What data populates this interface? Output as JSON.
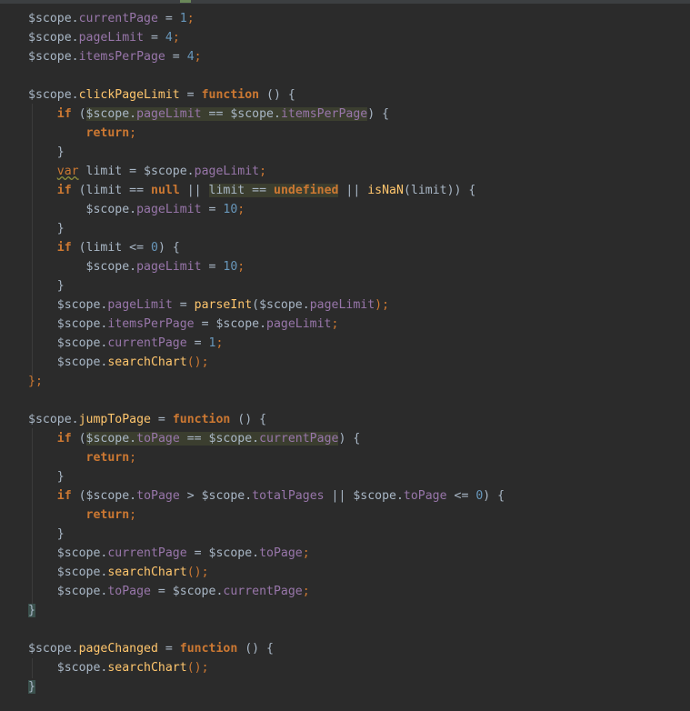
{
  "editor": {
    "language": "javascript",
    "theme": "darcula",
    "lines": [
      [
        [
          "$scope.",
          "plain"
        ],
        [
          "currentPage",
          "prop"
        ],
        [
          " = ",
          "plain"
        ],
        [
          "1",
          "num"
        ],
        [
          ";",
          "kwp"
        ]
      ],
      [
        [
          "$scope.",
          "plain"
        ],
        [
          "pageLimit",
          "prop"
        ],
        [
          " = ",
          "plain"
        ],
        [
          "4",
          "num"
        ],
        [
          ";",
          "kwp"
        ]
      ],
      [
        [
          "$scope.",
          "plain"
        ],
        [
          "itemsPerPage",
          "prop"
        ],
        [
          " = ",
          "plain"
        ],
        [
          "4",
          "num"
        ],
        [
          ";",
          "kwp"
        ]
      ],
      [],
      [
        [
          "$scope.",
          "plain"
        ],
        [
          "clickPageLimit",
          "fn"
        ],
        [
          " = ",
          "plain"
        ],
        [
          "function",
          "kw"
        ],
        [
          " () {",
          "plain"
        ]
      ],
      [
        [
          "    ",
          "plain"
        ],
        [
          "if",
          "kw"
        ],
        [
          " (",
          "plain"
        ],
        [
          "$scope.",
          "plain hl"
        ],
        [
          "pageLimit",
          "prop hl"
        ],
        [
          " == $scope.",
          "plain hl"
        ],
        [
          "itemsPerPage",
          "prop hl"
        ],
        [
          ") {",
          "plain"
        ]
      ],
      [
        [
          "        ",
          "plain"
        ],
        [
          "return",
          "kw"
        ],
        [
          ";",
          "kwp"
        ]
      ],
      [
        [
          "    }",
          "plain"
        ]
      ],
      [
        [
          "    ",
          "plain"
        ],
        [
          "var",
          "kwp squig"
        ],
        [
          " limit = $scope.",
          "plain"
        ],
        [
          "pageLimit",
          "prop"
        ],
        [
          ";",
          "kwp"
        ]
      ],
      [
        [
          "    ",
          "plain"
        ],
        [
          "if",
          "kw"
        ],
        [
          " (limit == ",
          "plain"
        ],
        [
          "null",
          "kw"
        ],
        [
          " || ",
          "plain"
        ],
        [
          "limit == ",
          "plain hl"
        ],
        [
          "undefined",
          "kw hl"
        ],
        [
          " || ",
          "plain"
        ],
        [
          "isNaN",
          "fn"
        ],
        [
          "(limit)) {",
          "plain"
        ]
      ],
      [
        [
          "        $scope.",
          "plain"
        ],
        [
          "pageLimit",
          "prop"
        ],
        [
          " = ",
          "plain"
        ],
        [
          "10",
          "num"
        ],
        [
          ";",
          "kwp"
        ]
      ],
      [
        [
          "    }",
          "plain"
        ]
      ],
      [
        [
          "    ",
          "plain"
        ],
        [
          "if",
          "kw"
        ],
        [
          " (limit <= ",
          "plain"
        ],
        [
          "0",
          "num"
        ],
        [
          ") {",
          "plain"
        ]
      ],
      [
        [
          "        $scope.",
          "plain"
        ],
        [
          "pageLimit",
          "prop"
        ],
        [
          " = ",
          "plain"
        ],
        [
          "10",
          "num"
        ],
        [
          ";",
          "kwp"
        ]
      ],
      [
        [
          "    }",
          "plain"
        ]
      ],
      [
        [
          "    $scope.",
          "plain"
        ],
        [
          "pageLimit",
          "prop"
        ],
        [
          " = ",
          "plain"
        ],
        [
          "parseInt",
          "fn"
        ],
        [
          "($scope.",
          "plain"
        ],
        [
          "pageLimit",
          "prop"
        ],
        [
          ");",
          "kwp"
        ]
      ],
      [
        [
          "    $scope.",
          "plain"
        ],
        [
          "itemsPerPage",
          "prop"
        ],
        [
          " = $scope.",
          "plain"
        ],
        [
          "pageLimit",
          "prop"
        ],
        [
          ";",
          "kwp"
        ]
      ],
      [
        [
          "    $scope.",
          "plain"
        ],
        [
          "currentPage",
          "prop"
        ],
        [
          " = ",
          "plain"
        ],
        [
          "1",
          "num"
        ],
        [
          ";",
          "kwp"
        ]
      ],
      [
        [
          "    $scope.",
          "plain"
        ],
        [
          "searchChart",
          "fn"
        ],
        [
          "();",
          "kwp"
        ]
      ],
      [
        [
          "};",
          "kwp"
        ]
      ],
      [],
      [
        [
          "$scope.",
          "plain"
        ],
        [
          "jumpToPage",
          "fn"
        ],
        [
          " = ",
          "plain"
        ],
        [
          "function",
          "kw"
        ],
        [
          " () {",
          "plain"
        ]
      ],
      [
        [
          "    ",
          "plain"
        ],
        [
          "if",
          "kw"
        ],
        [
          " (",
          "plain"
        ],
        [
          "$scope.",
          "plain hl"
        ],
        [
          "toPage",
          "prop hl"
        ],
        [
          " == $scope.",
          "plain hl"
        ],
        [
          "currentPage",
          "prop hl"
        ],
        [
          ") {",
          "plain"
        ]
      ],
      [
        [
          "        ",
          "plain"
        ],
        [
          "return",
          "kw"
        ],
        [
          ";",
          "kwp"
        ]
      ],
      [
        [
          "    }",
          "plain"
        ]
      ],
      [
        [
          "    ",
          "plain"
        ],
        [
          "if",
          "kw"
        ],
        [
          " ($scope.",
          "plain"
        ],
        [
          "toPage",
          "prop"
        ],
        [
          " > $scope.",
          "plain"
        ],
        [
          "totalPages",
          "prop"
        ],
        [
          " || $scope.",
          "plain"
        ],
        [
          "toPage",
          "prop"
        ],
        [
          " <= ",
          "plain"
        ],
        [
          "0",
          "num"
        ],
        [
          ") {",
          "plain"
        ]
      ],
      [
        [
          "        ",
          "plain"
        ],
        [
          "return",
          "kw"
        ],
        [
          ";",
          "kwp"
        ]
      ],
      [
        [
          "    }",
          "plain"
        ]
      ],
      [
        [
          "    $scope.",
          "plain"
        ],
        [
          "currentPage",
          "prop"
        ],
        [
          " = $scope.",
          "plain"
        ],
        [
          "toPage",
          "prop"
        ],
        [
          ";",
          "kwp"
        ]
      ],
      [
        [
          "    $scope.",
          "plain"
        ],
        [
          "searchChart",
          "fn"
        ],
        [
          "();",
          "kwp"
        ]
      ],
      [
        [
          "    $scope.",
          "plain"
        ],
        [
          "toPage",
          "prop"
        ],
        [
          " = $scope.",
          "plain"
        ],
        [
          "currentPage",
          "prop"
        ],
        [
          ";",
          "kwp"
        ]
      ],
      [
        [
          "}",
          "plain brace-hl"
        ]
      ],
      [],
      [
        [
          "$scope.",
          "plain"
        ],
        [
          "pageChanged",
          "fn"
        ],
        [
          " = ",
          "plain"
        ],
        [
          "function",
          "kw"
        ],
        [
          " () {",
          "plain"
        ]
      ],
      [
        [
          "    $scope.",
          "plain"
        ],
        [
          "searchChart",
          "fn"
        ],
        [
          "();",
          "kwp"
        ]
      ],
      [
        [
          "}",
          "plain brace-hl"
        ]
      ]
    ]
  }
}
